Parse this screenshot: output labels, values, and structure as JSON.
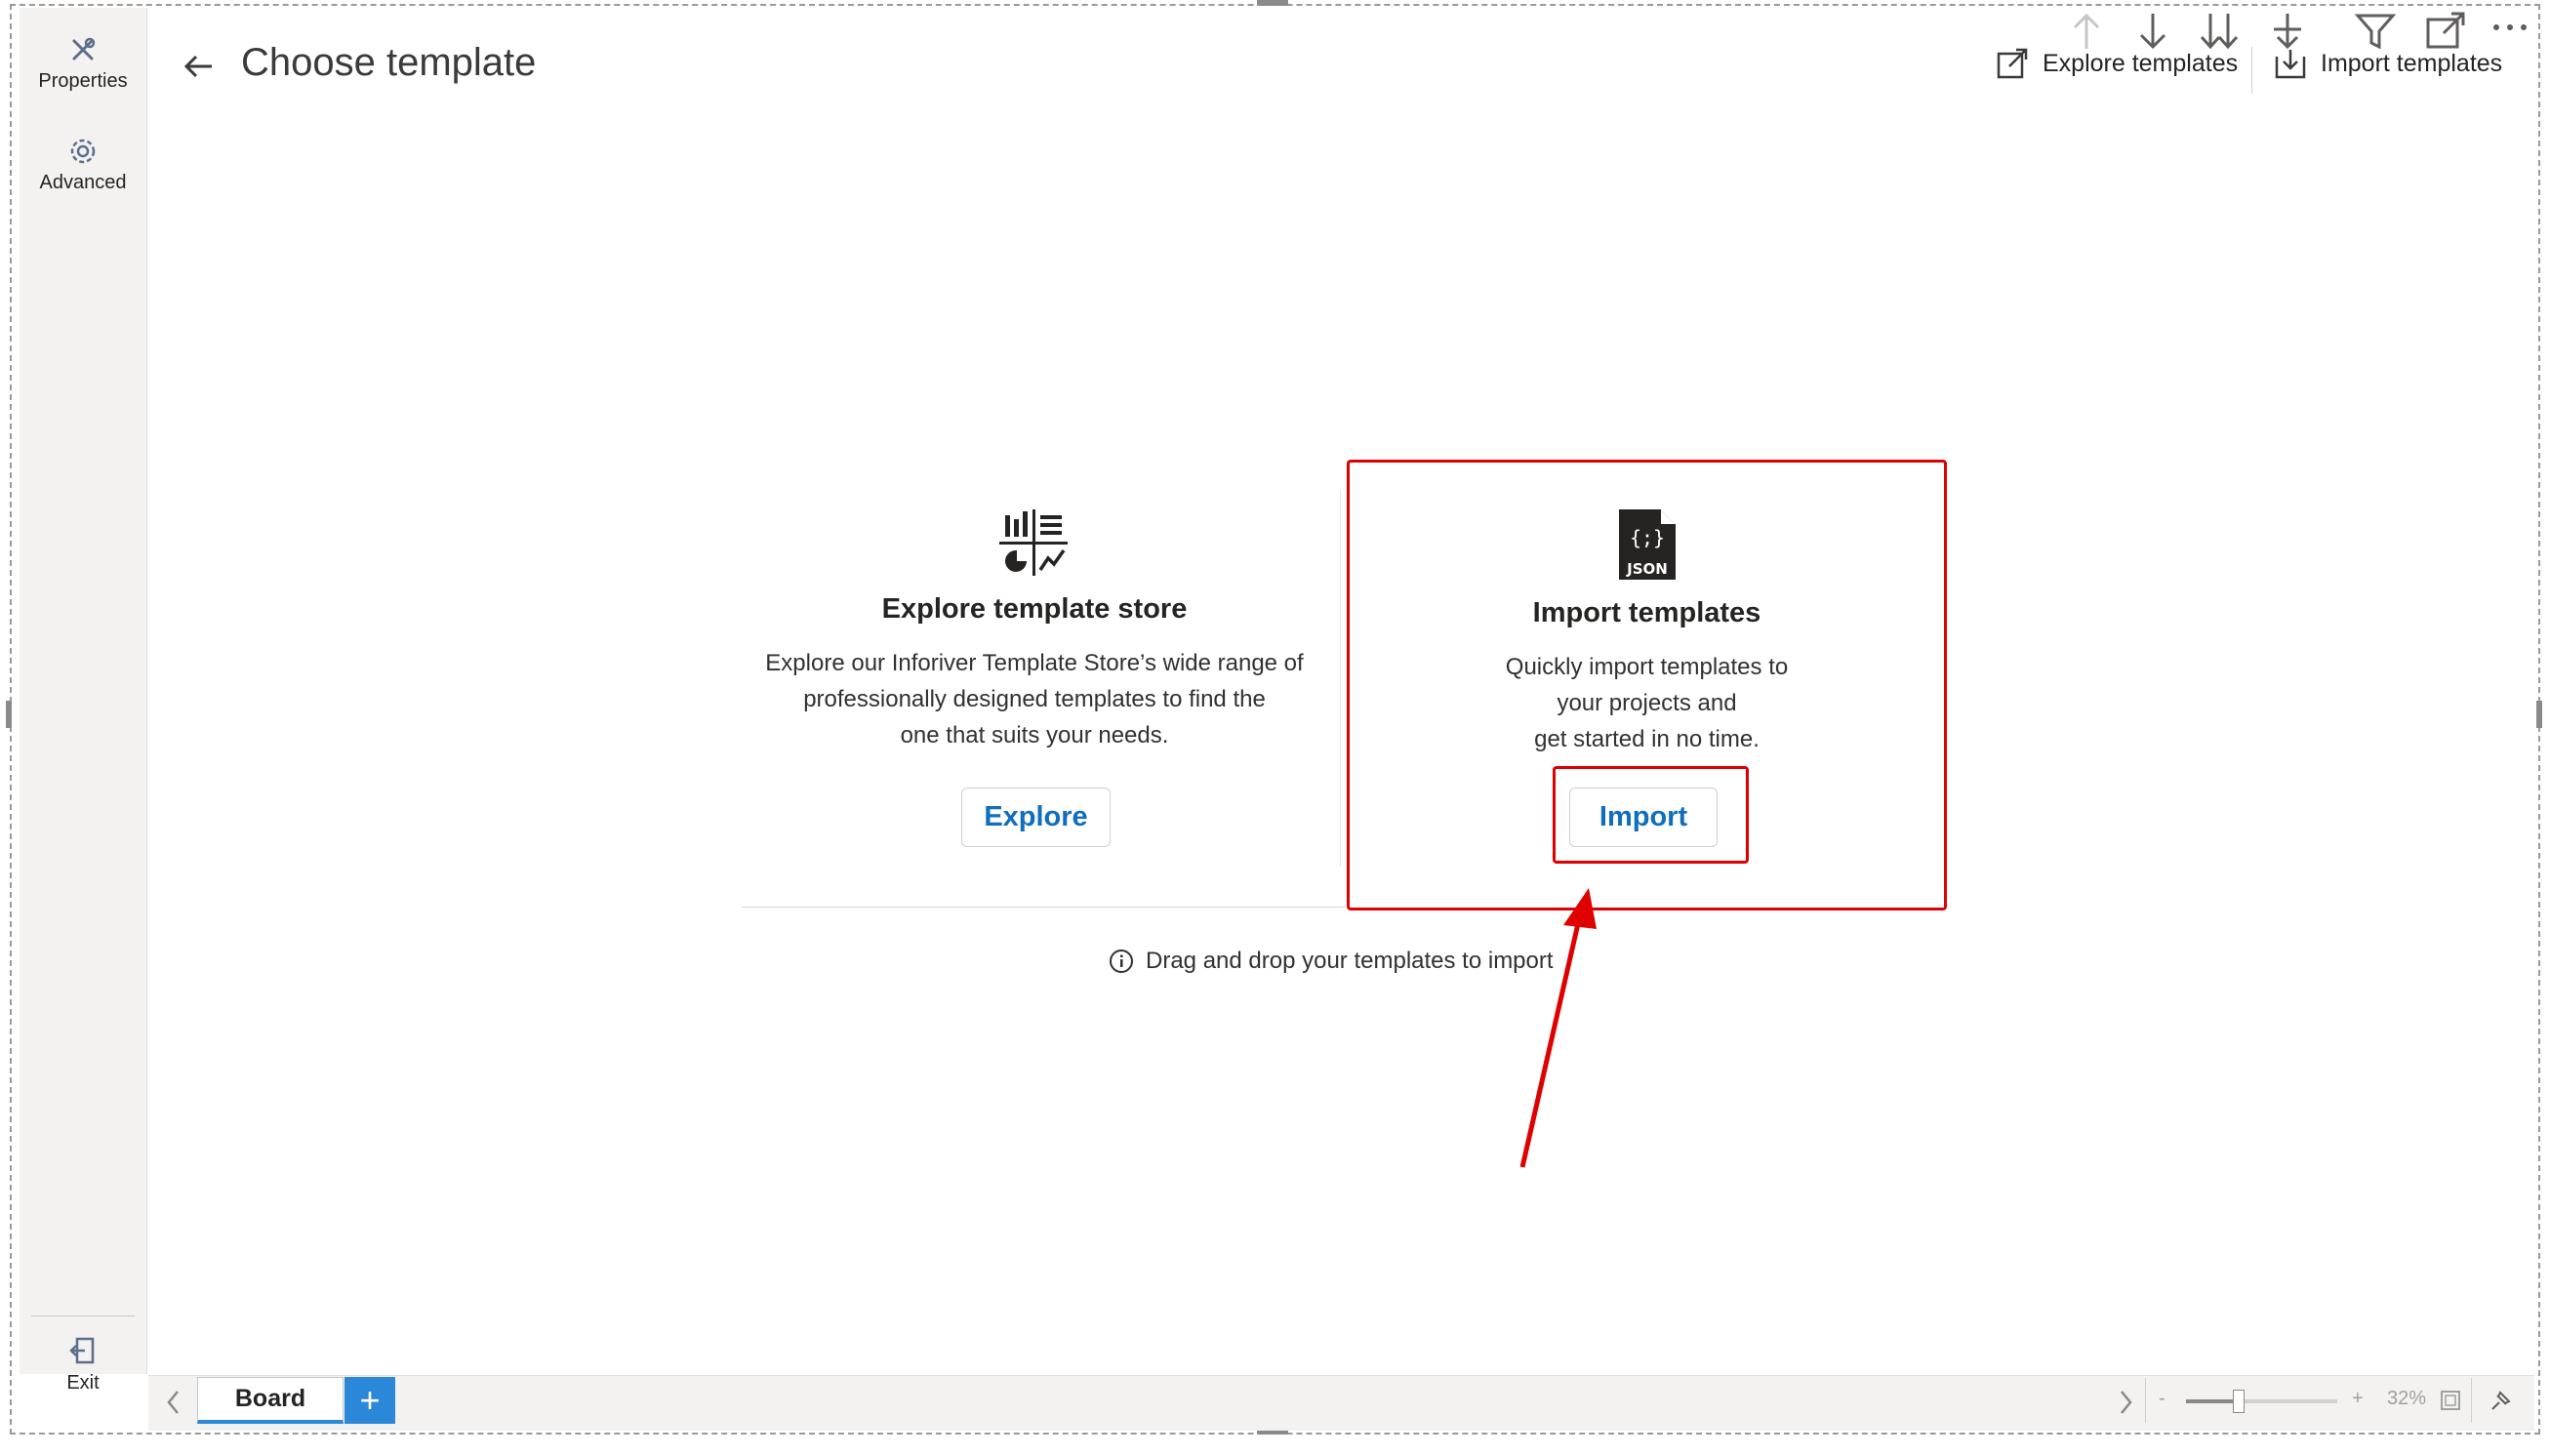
{
  "sidebar": {
    "items": [
      {
        "label": "Properties",
        "icon": "tools-icon"
      },
      {
        "label": "Advanced",
        "icon": "gear-icon"
      }
    ],
    "exit_label": "Exit"
  },
  "header": {
    "title": "Choose template",
    "explore_link": "Explore templates",
    "import_link": "Import templates"
  },
  "cards": {
    "explore": {
      "icon": "template-store-icon",
      "title": "Explore template store",
      "desc_lines": [
        "Explore our Inforiver Template Store’s wide range of",
        "professionally designed templates to find the",
        "one that suits your needs."
      ],
      "button": "Explore"
    },
    "import": {
      "icon": "json-file-icon",
      "icon_text": "JSON",
      "title": "Import templates",
      "desc_lines": [
        "Quickly import templates to",
        "your projects and",
        "get started in no time."
      ],
      "button": "Import"
    }
  },
  "hint": "Drag and drop your templates to import",
  "bottom": {
    "tab_label": "Board",
    "add_label": "+",
    "zoom_minus": "-",
    "zoom_plus": "+",
    "zoom_percent": "32%"
  },
  "colors": {
    "accent": "#106ebe",
    "tab_accent": "#2b88d8",
    "highlight": "#e00000"
  }
}
